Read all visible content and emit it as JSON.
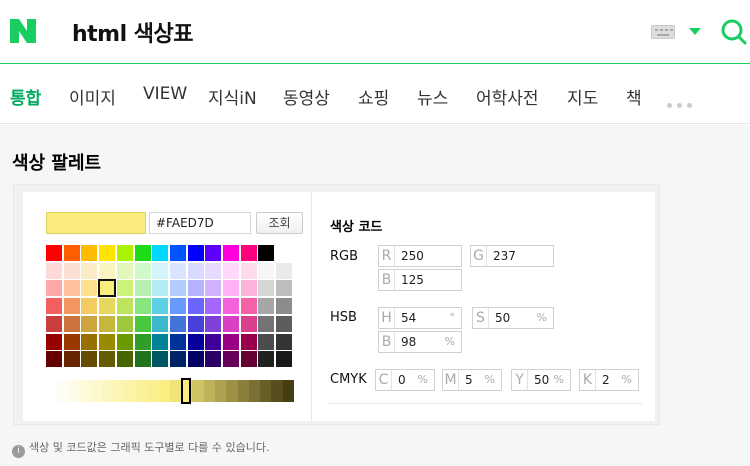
{
  "header": {
    "logo": "N",
    "query": "html 색상표",
    "icons": [
      "keyboard-icon",
      "dropdown-arrow-icon",
      "search-icon"
    ],
    "accent": "#19ce60"
  },
  "tabs": [
    "통합",
    "이미지",
    "VIEW",
    "지식iN",
    "동영상",
    "쇼핑",
    "뉴스",
    "어학사전",
    "지도",
    "책"
  ],
  "active_tab": "통합",
  "palette": {
    "title": "색상 팔레트",
    "current_hex": "#FAED7D",
    "lookup_button": "조회",
    "codes_title": "색상 코드",
    "rgb": {
      "label": "RGB",
      "r": {
        "key": "R",
        "value": "250"
      },
      "g": {
        "key": "G",
        "value": "237"
      },
      "b": {
        "key": "B",
        "value": "125"
      }
    },
    "hsb": {
      "label": "HSB",
      "h": {
        "key": "H",
        "value": "54",
        "unit": "°"
      },
      "s": {
        "key": "S",
        "value": "50",
        "unit": "%"
      },
      "b": {
        "key": "B",
        "value": "98",
        "unit": "%"
      }
    },
    "cmyk": {
      "label": "CMYK",
      "c": {
        "key": "C",
        "value": "0",
        "unit": "%"
      },
      "m": {
        "key": "M",
        "value": "5",
        "unit": "%"
      },
      "y": {
        "key": "Y",
        "value": "50",
        "unit": "%"
      },
      "k": {
        "key": "K",
        "value": "2",
        "unit": "%"
      }
    },
    "grid_colors": [
      [
        "#FF0000",
        "#FF5E00",
        "#FFBB00",
        "#FFE400",
        "#ABF200",
        "#1DDB16",
        "#00D8FF",
        "#0054FF",
        "#0100FF",
        "#5F00FF",
        "#FF00DD",
        "#FF007F",
        "#000000",
        "#FFFFFF"
      ],
      [
        "#FFD8D8",
        "#FAE0D4",
        "#FAECC5",
        "#FAF4C0",
        "#E4F7BA",
        "#CEFBC9",
        "#D4F4FA",
        "#D9E5FF",
        "#DAD9FF",
        "#E8D9FF",
        "#FFD9FA",
        "#FFD9EC",
        "#F6F6F6",
        "#EAEAEA"
      ],
      [
        "#FFA7A7",
        "#FFC19E",
        "#FFE08C",
        "#FAED7D",
        "#CEF279",
        "#B7F0B1",
        "#B2EBF4",
        "#B2CCFF",
        "#B5B2FF",
        "#D1B2FF",
        "#FFB2F5",
        "#FFB2D9",
        "#D5D5D5",
        "#BDBDBD"
      ],
      [
        "#F15F5F",
        "#F29661",
        "#F2CB61",
        "#E5D85C",
        "#BCE55C",
        "#86E57F",
        "#5CD1E5",
        "#6799FF",
        "#6B66FF",
        "#A566FF",
        "#F361DC",
        "#F361A6",
        "#A6A6A6",
        "#8C8C8C"
      ],
      [
        "#CC3D3D",
        "#CC723D",
        "#CCA63D",
        "#C4B73B",
        "#9FC93C",
        "#47C83E",
        "#3DB7CC",
        "#4374D9",
        "#4641D9",
        "#8041D9",
        "#D941C5",
        "#D9418C",
        "#747474",
        "#5D5D5D"
      ],
      [
        "#980000",
        "#993800",
        "#997000",
        "#998A00",
        "#6B9900",
        "#2F9D27",
        "#008299",
        "#003399",
        "#050099",
        "#3F0099",
        "#990085",
        "#99004C",
        "#4C4C4C",
        "#353535"
      ],
      [
        "#670000",
        "#662500",
        "#664B00",
        "#665C00",
        "#476600",
        "#22741C",
        "#005766",
        "#002266",
        "#030066",
        "#2A0066",
        "#660058",
        "#660033",
        "#212121",
        "#191919"
      ]
    ],
    "selected_cell": "#FAED7D",
    "note": "색상 및 코드값은 그래픽 도구별로 다를 수 있습니다."
  }
}
